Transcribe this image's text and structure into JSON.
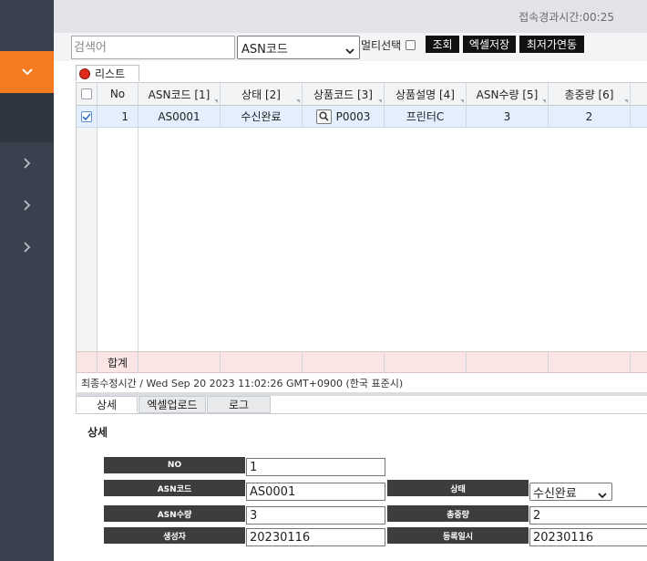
{
  "header": {
    "connection_elapsed": "접속경과시간:00:25"
  },
  "toolbar": {
    "search_placeholder": "검색어",
    "search_value": "",
    "field_select": "ASN코드",
    "multi_select_label": "멀티선택",
    "search_button": "조회",
    "excel_save_button": "엑셀저장",
    "sync_button": "최저가연동"
  },
  "list": {
    "tab_label": "리스트",
    "columns": [
      "No",
      "ASN코드 [1]",
      "상태 [2]",
      "상품코드 [3]",
      "상품설명 [4]",
      "ASN수량 [5]",
      "총중량 [6]"
    ],
    "rows": [
      {
        "checked": true,
        "no": "1",
        "asn_code": "AS0001",
        "status": "수신완료",
        "product_code": "P0003",
        "product_desc": "프린터C",
        "asn_qty": "3",
        "total_weight": "2"
      }
    ],
    "sum_label": "합계",
    "last_modified": "최종수정시간 / Wed Sep 20 2023 11:02:26 GMT+0900 (한국 표준시)"
  },
  "bottom_tabs": [
    "상세",
    "엑셀업로드",
    "로그"
  ],
  "detail": {
    "title": "상세",
    "labels": {
      "no": "NO",
      "asn_code": "ASN코드",
      "status": "상태",
      "asn_qty": "ASN수량",
      "total_weight": "총중량",
      "creator": "생성자",
      "reg_date": "등록일시"
    },
    "values": {
      "no": "1",
      "asn_code": "AS0001",
      "status": "수신완료",
      "asn_qty": "3",
      "total_weight": "2",
      "creator": "20230116",
      "reg_date": "20230116"
    }
  },
  "colors": {
    "accent": "#f47b20",
    "sidebar": "#38414d",
    "selected_row": "#e3effc",
    "sum_row": "#fbe4e4",
    "label_bg": "#3d3d3d"
  }
}
